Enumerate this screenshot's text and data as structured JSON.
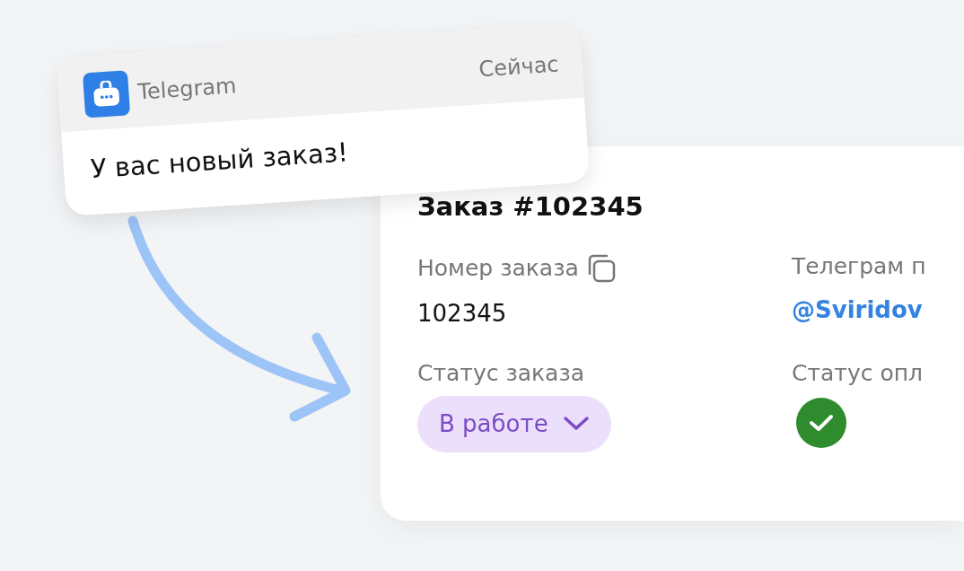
{
  "notification": {
    "app": "Telegram",
    "time": "Сейчас",
    "message": "У вас новый заказ!"
  },
  "order": {
    "title": "Заказ #102345",
    "fields": [
      {
        "kind": "copyable",
        "label": "Номер заказа",
        "value": "102345"
      },
      {
        "kind": "link",
        "label": "Телеграм п",
        "value": "@Sviridov"
      },
      {
        "kind": "dropdown",
        "label": "Статус заказа",
        "value": "В работе"
      },
      {
        "kind": "status",
        "label": "Статус опл",
        "checked": true
      }
    ]
  }
}
